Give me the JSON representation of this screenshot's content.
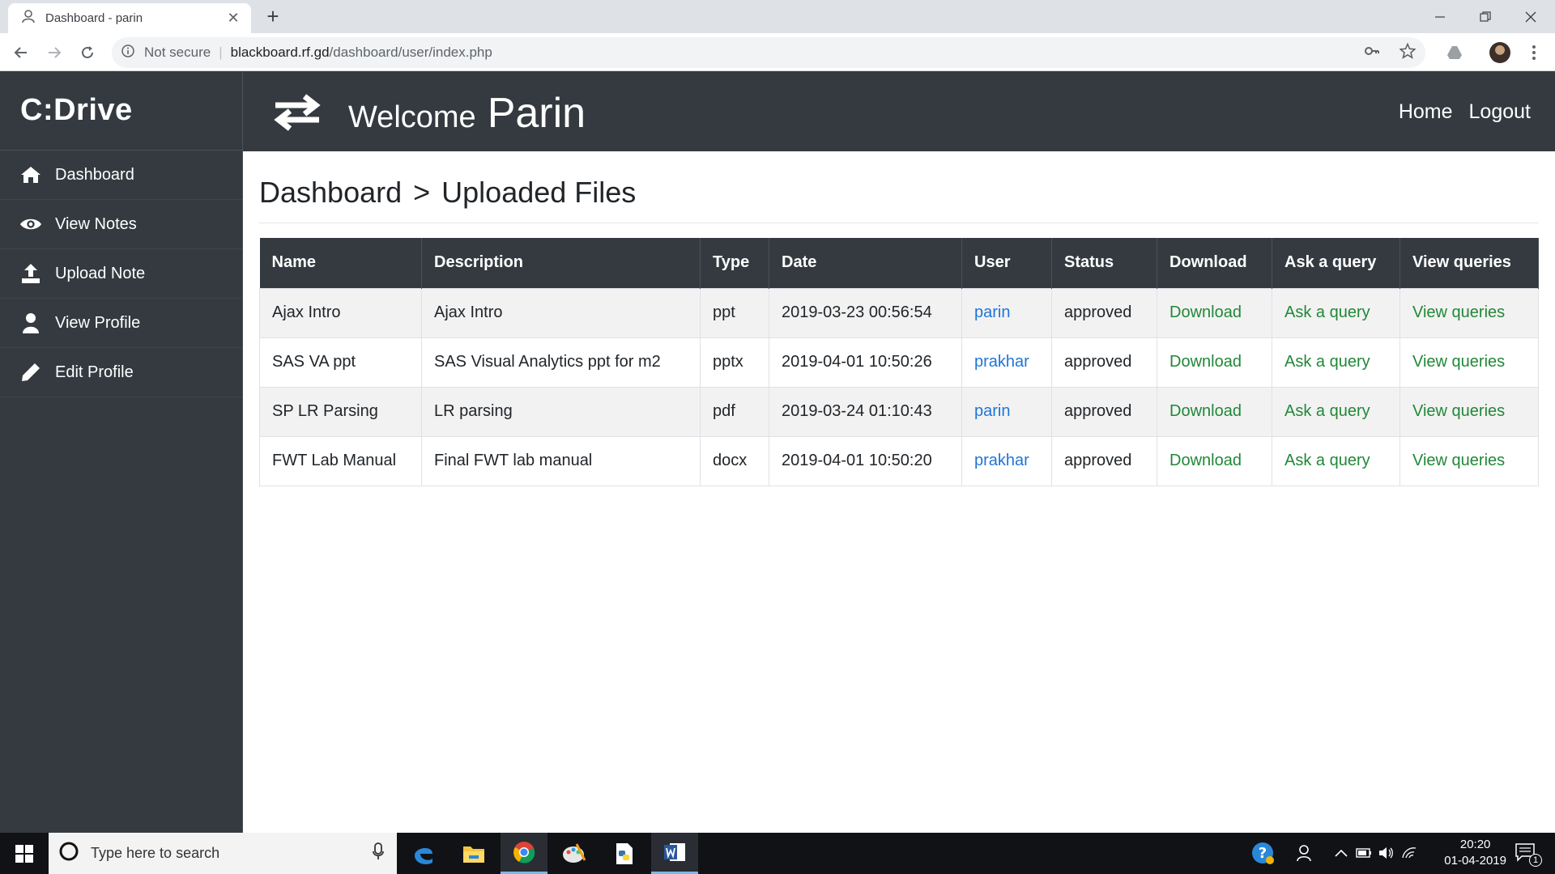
{
  "browser": {
    "tab_title": "Dashboard - parin",
    "tab_close": "✕",
    "new_tab": "+",
    "security_label": "Not secure",
    "url_host": "blackboard.rf.gd",
    "url_path": "/dashboard/user/index.php"
  },
  "sidebar": {
    "brand": "C:Drive",
    "items": [
      {
        "label": "Dashboard",
        "icon": "home-icon"
      },
      {
        "label": "View Notes",
        "icon": "eye-icon"
      },
      {
        "label": "Upload Note",
        "icon": "upload-icon"
      },
      {
        "label": "View Profile",
        "icon": "user-icon"
      },
      {
        "label": "Edit Profile",
        "icon": "pencil-icon"
      }
    ]
  },
  "header": {
    "welcome": "Welcome",
    "user_name": "Parin",
    "home_link": "Home",
    "logout_link": "Logout"
  },
  "main": {
    "breadcrumb": {
      "root": "Dashboard",
      "separator": ">",
      "current": "Uploaded Files"
    },
    "table": {
      "columns": [
        "Name",
        "Description",
        "Type",
        "Date",
        "User",
        "Status",
        "Download",
        "Ask a query",
        "View queries"
      ],
      "rows": [
        {
          "name": "Ajax Intro",
          "description": "Ajax Intro",
          "type": "ppt",
          "date": "2019-03-23 00:56:54",
          "user": "parin",
          "status": "approved",
          "download": "Download",
          "ask": "Ask a query",
          "view": "View queries"
        },
        {
          "name": "SAS VA ppt",
          "description": "SAS Visual Analytics ppt for m2",
          "type": "pptx",
          "date": "2019-04-01 10:50:26",
          "user": "prakhar",
          "status": "approved",
          "download": "Download",
          "ask": "Ask a query",
          "view": "View queries"
        },
        {
          "name": "SP LR Parsing",
          "description": "LR parsing",
          "type": "pdf",
          "date": "2019-03-24 01:10:43",
          "user": "parin",
          "status": "approved",
          "download": "Download",
          "ask": "Ask a query",
          "view": "View queries"
        },
        {
          "name": "FWT Lab Manual",
          "description": "Final FWT lab manual",
          "type": "docx",
          "date": "2019-04-01 10:50:20",
          "user": "prakhar",
          "status": "approved",
          "download": "Download",
          "ask": "Ask a query",
          "view": "View queries"
        }
      ]
    }
  },
  "taskbar": {
    "search_placeholder": "Type here to search",
    "time": "20:20",
    "date": "01-04-2019",
    "notification_count": "1"
  },
  "colors": {
    "sidebar_bg": "#343a40",
    "user_link": "#1f75d8",
    "action_link": "#218838"
  }
}
